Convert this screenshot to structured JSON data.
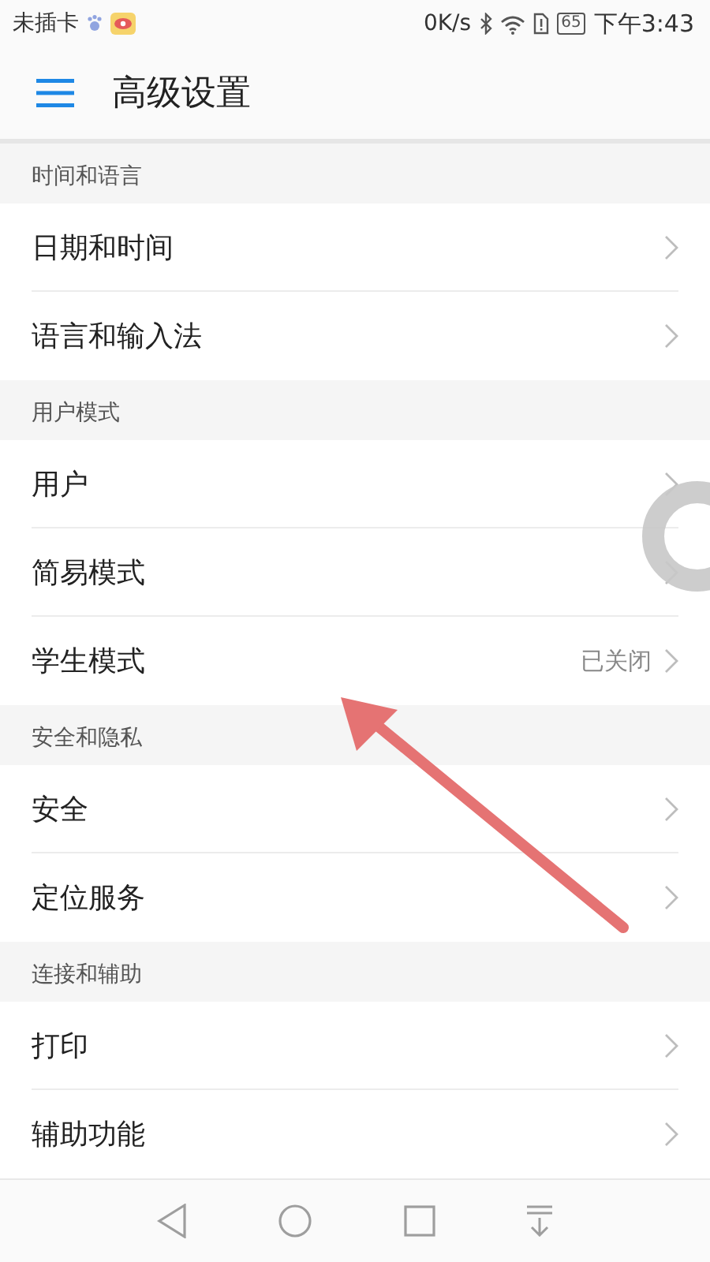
{
  "status_bar": {
    "carrier": "未插卡",
    "speed": "0K/s",
    "battery": "65",
    "time": "下午3:43"
  },
  "app_bar": {
    "title": "高级设置"
  },
  "sections": [
    {
      "title": "时间和语言",
      "items": [
        {
          "label": "日期和时间"
        },
        {
          "label": "语言和输入法"
        }
      ]
    },
    {
      "title": "用户模式",
      "items": [
        {
          "label": "用户"
        },
        {
          "label": "简易模式"
        },
        {
          "label": "学生模式",
          "value": "已关闭"
        }
      ]
    },
    {
      "title": "安全和隐私",
      "items": [
        {
          "label": "安全"
        },
        {
          "label": "定位服务"
        }
      ]
    },
    {
      "title": "连接和辅助",
      "items": [
        {
          "label": "打印"
        },
        {
          "label": "辅助功能"
        }
      ]
    }
  ]
}
